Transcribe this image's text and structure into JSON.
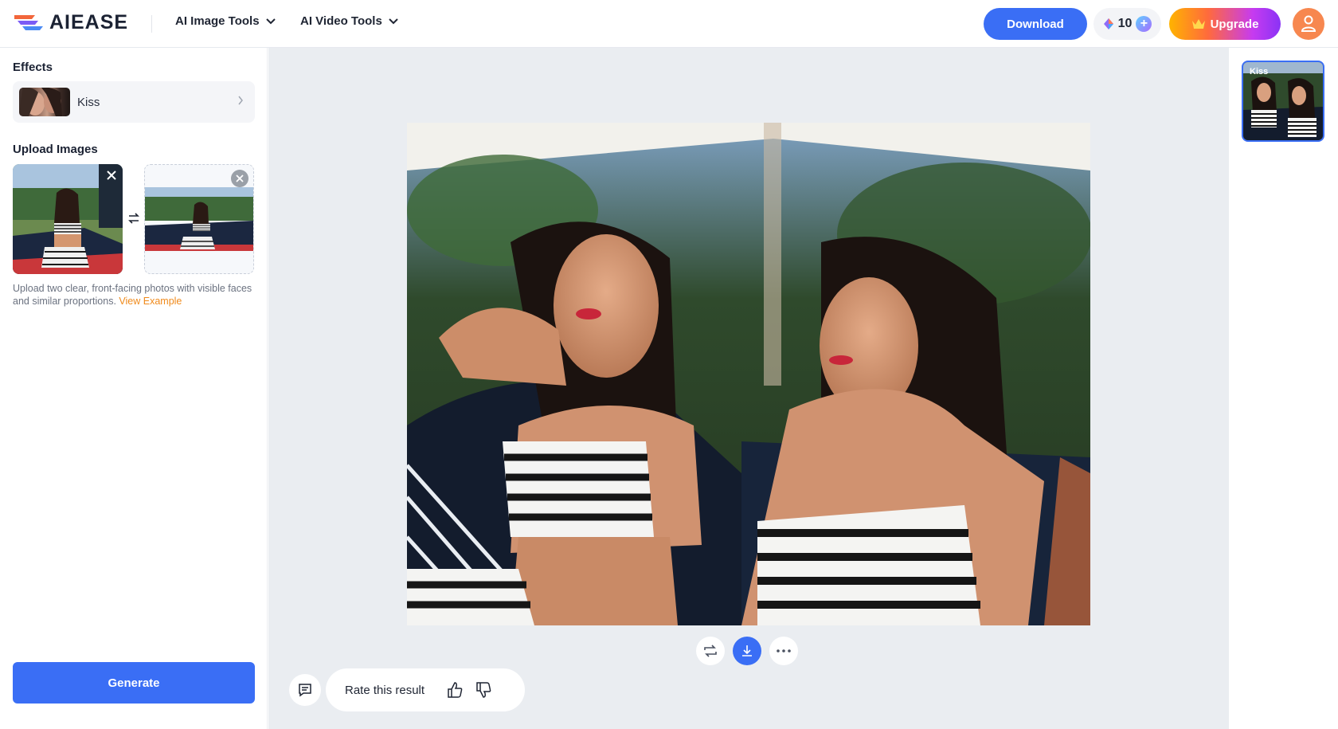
{
  "header": {
    "logo_text": "AIEASE",
    "nav": [
      {
        "label": "AI Image Tools"
      },
      {
        "label": "AI Video Tools"
      }
    ],
    "download_label": "Download",
    "credits": "10",
    "upgrade_label": "Upgrade"
  },
  "sidebar": {
    "effects_title": "Effects",
    "effect_name": "Kiss",
    "upload_title": "Upload Images",
    "hint_text": "Upload two clear, front-facing photos with visible faces and similar proportions.",
    "hint_link": "View Example",
    "generate_label": "Generate"
  },
  "main": {
    "rate_label": "Rate this result"
  },
  "rail": {
    "thumb_label": "Kiss"
  },
  "colors": {
    "accent": "#3a6ef5",
    "link_orange": "#f08a1b",
    "avatar_bg": "#f7874f"
  },
  "icons": [
    "logo-icon",
    "chevron-down-icon",
    "credit-gem-icon",
    "plus-icon",
    "crown-icon",
    "user-icon",
    "chevron-right-icon",
    "close-icon",
    "swap-icon",
    "regenerate-icon",
    "download-icon",
    "more-icon",
    "feedback-icon",
    "thumbs-up-icon",
    "thumbs-down-icon"
  ]
}
